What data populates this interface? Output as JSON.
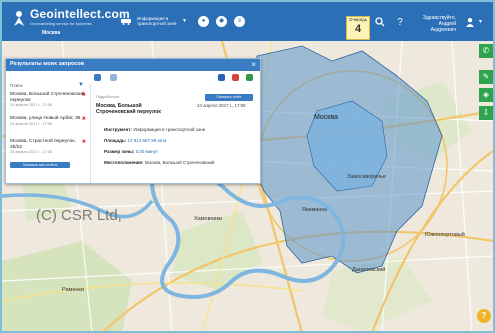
{
  "header": {
    "logo_text": "Geointellect.com",
    "logo_sub": "Geomarketing service for business",
    "city": "Москва",
    "info_tool_label": "Информация в транспортной зоне",
    "queue_label": "Очередь",
    "queue_count": "4",
    "user_greeting": "Здравствуйте,",
    "user_name": "Андрей Андреевич"
  },
  "panel": {
    "title": "Результаты моих запросов",
    "close": "×",
    "list_header": "Поиск",
    "items": [
      {
        "title": "Москва, Большой Строченовский переулок",
        "date": "24 апреля 2017 г., 17:08"
      },
      {
        "title": "Москва, улица Новый Арбат, 36",
        "date": "24 апреля 2017 г., 17:08"
      },
      {
        "title": "Москва, Страстной переулок, 25/22",
        "date": "24 апреля 2017 г., 17:06"
      }
    ],
    "show_all": "Показать все отчёты",
    "detail": {
      "subtitle": "Подробности",
      "show_report": "Показать отчёт",
      "title": "Москва, Большой Строченовский переулок",
      "date": "24 апреля 2017 г., 17:08",
      "tool_label": "Инструмент:",
      "tool_value": "Информация в транспортной зоне",
      "area_label": "Площадь:",
      "area_value": "14 813 587,99 кв.м",
      "size_label": "Размер зоны:",
      "size_value": "5.00 минут",
      "place_label": "Местоположение:",
      "place_value": "Москва, Большой Строченовский"
    }
  },
  "map_labels": {
    "moscow": "Москва",
    "zamoskvorechye": "Замоскворечье",
    "khamovniki": "Хамовники",
    "yakimanka": "Якиманка",
    "danilovsky": "Даниловский",
    "yuzhnoportovy": "Южнопортовый",
    "ramenki": "Раменки"
  },
  "watermark": "(C) CSR Ltd,",
  "colors": {
    "header": "#2b6fb6",
    "zone_fill": "#5b94cc",
    "zone_core": "#7ab3e0",
    "green_tools": "#2fa34e",
    "queue_bg": "#fdf3b6"
  },
  "icons": [
    "car-icon",
    "globe-icon",
    "layers-icon",
    "search-icon",
    "help-icon",
    "user-icon",
    "phone-icon",
    "pencil-icon",
    "layers-icon",
    "download-icon"
  ]
}
